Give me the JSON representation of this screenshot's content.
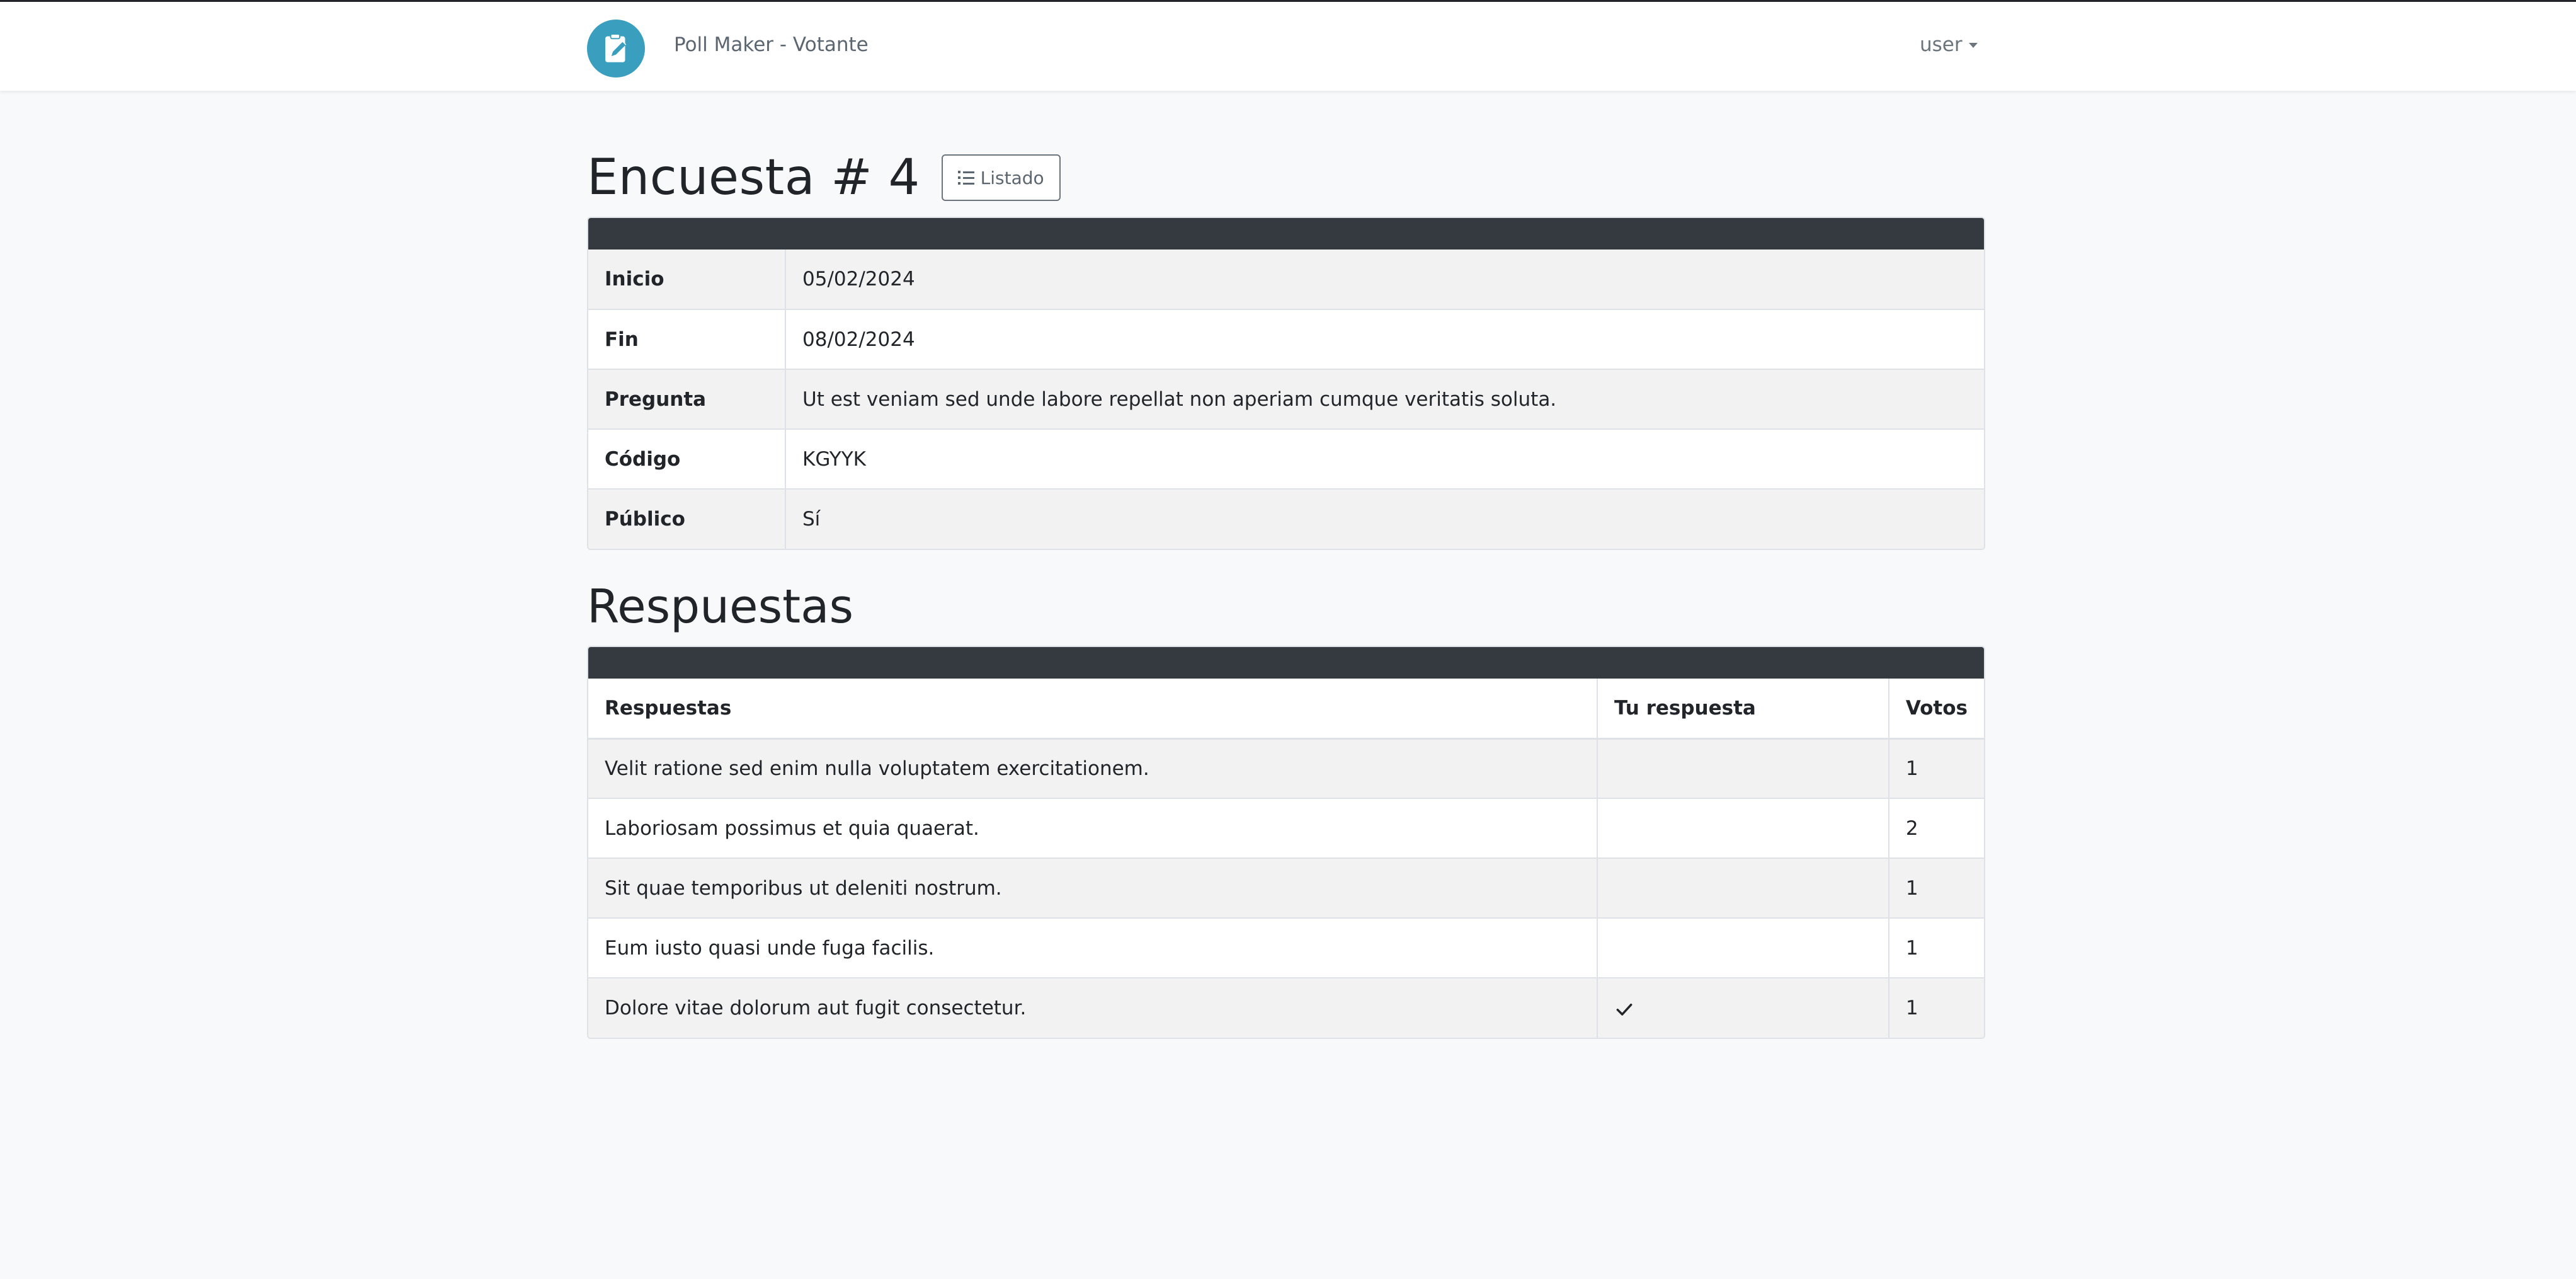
{
  "navbar": {
    "brand_title": "Poll Maker - Votante",
    "logo_icon": "clipboard-edit-icon",
    "user_label": "user"
  },
  "page": {
    "title": "Encuesta # 4",
    "list_button_label": "Listado"
  },
  "details": {
    "rows": [
      {
        "label": "Inicio",
        "value": "05/02/2024"
      },
      {
        "label": "Fin",
        "value": "08/02/2024"
      },
      {
        "label": "Pregunta",
        "value": "Ut est veniam sed unde labore repellat non aperiam cumque veritatis soluta."
      },
      {
        "label": "Código",
        "value": "KGYYK"
      },
      {
        "label": "Público",
        "value": "Sí"
      }
    ]
  },
  "answers": {
    "section_title": "Respuestas",
    "headers": {
      "answer": "Respuestas",
      "yours": "Tu respuesta",
      "votes": "Votos"
    },
    "rows": [
      {
        "answer": "Velit ratione sed enim nulla voluptatem exercitationem.",
        "selected": false,
        "votes": "1"
      },
      {
        "answer": "Laboriosam possimus et quia quaerat.",
        "selected": false,
        "votes": "2"
      },
      {
        "answer": "Sit quae temporibus ut deleniti nostrum.",
        "selected": false,
        "votes": "1"
      },
      {
        "answer": "Eum iusto quasi unde fuga facilis.",
        "selected": false,
        "votes": "1"
      },
      {
        "answer": "Dolore vitae dolorum aut fugit consectetur.",
        "selected": true,
        "votes": "1"
      }
    ]
  },
  "colors": {
    "brand": "#3a9fbf",
    "card_header": "#343a40",
    "background": "#f8f9fa"
  }
}
